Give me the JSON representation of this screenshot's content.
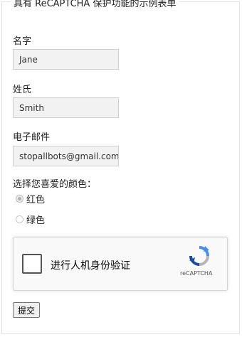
{
  "form": {
    "legend": "具有 ReCAPTCHA 保护功能的示例表单",
    "first_name": {
      "label": "名字",
      "value": "Jane"
    },
    "last_name": {
      "label": "姓氏",
      "value": "Smith"
    },
    "email": {
      "label": "电子邮件",
      "value": "stopallbots@gmail.com"
    },
    "color": {
      "label": "选择您喜爱的颜色：",
      "options": [
        {
          "label": "红色",
          "checked": true
        },
        {
          "label": "绿色",
          "checked": false
        }
      ]
    },
    "recaptcha": {
      "checkbox_label": "进行人机身份验证",
      "brand": "reCAPTCHA"
    },
    "submit_label": "提交"
  }
}
